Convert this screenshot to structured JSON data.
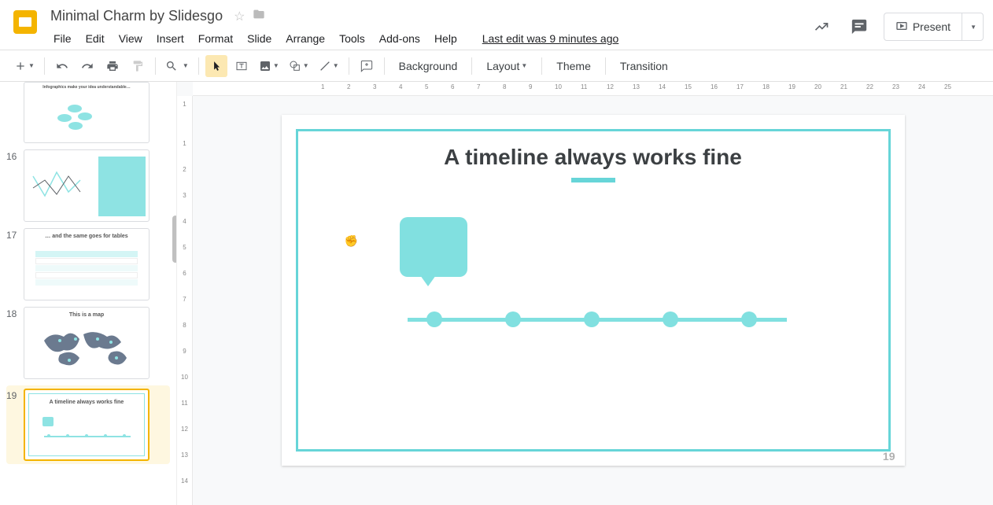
{
  "doc": {
    "title": "Minimal Charm by Slidesgo",
    "last_edit": "Last edit was 9 minutes ago"
  },
  "menu": {
    "file": "File",
    "edit": "Edit",
    "view": "View",
    "insert": "Insert",
    "format": "Format",
    "slide": "Slide",
    "arrange": "Arrange",
    "tools": "Tools",
    "addons": "Add-ons",
    "help": "Help"
  },
  "header": {
    "present": "Present"
  },
  "toolbar": {
    "background": "Background",
    "layout": "Layout",
    "theme": "Theme",
    "transition": "Transition"
  },
  "thumbs": {
    "t15_title": "Infographics make your idea understandable…",
    "n16": "16",
    "t16_title": "",
    "n17": "17",
    "t17_title": "… and the same goes for tables",
    "n18": "18",
    "t18_title": "This is a map",
    "n19": "19",
    "t19_title": "A timeline always works fine"
  },
  "slide": {
    "title": "A timeline always works fine",
    "page_num": "19"
  },
  "hruler": [
    "1",
    "2",
    "3",
    "4",
    "5",
    "6",
    "7",
    "8",
    "9",
    "10",
    "11",
    "12",
    "13",
    "14",
    "15",
    "16",
    "17",
    "18",
    "19",
    "20",
    "21",
    "22",
    "23",
    "24",
    "25"
  ],
  "vruler_top": [
    "1"
  ],
  "vruler": [
    "1",
    "2",
    "3",
    "4",
    "5",
    "6",
    "7",
    "8",
    "9",
    "10",
    "11",
    "12",
    "13",
    "14"
  ]
}
